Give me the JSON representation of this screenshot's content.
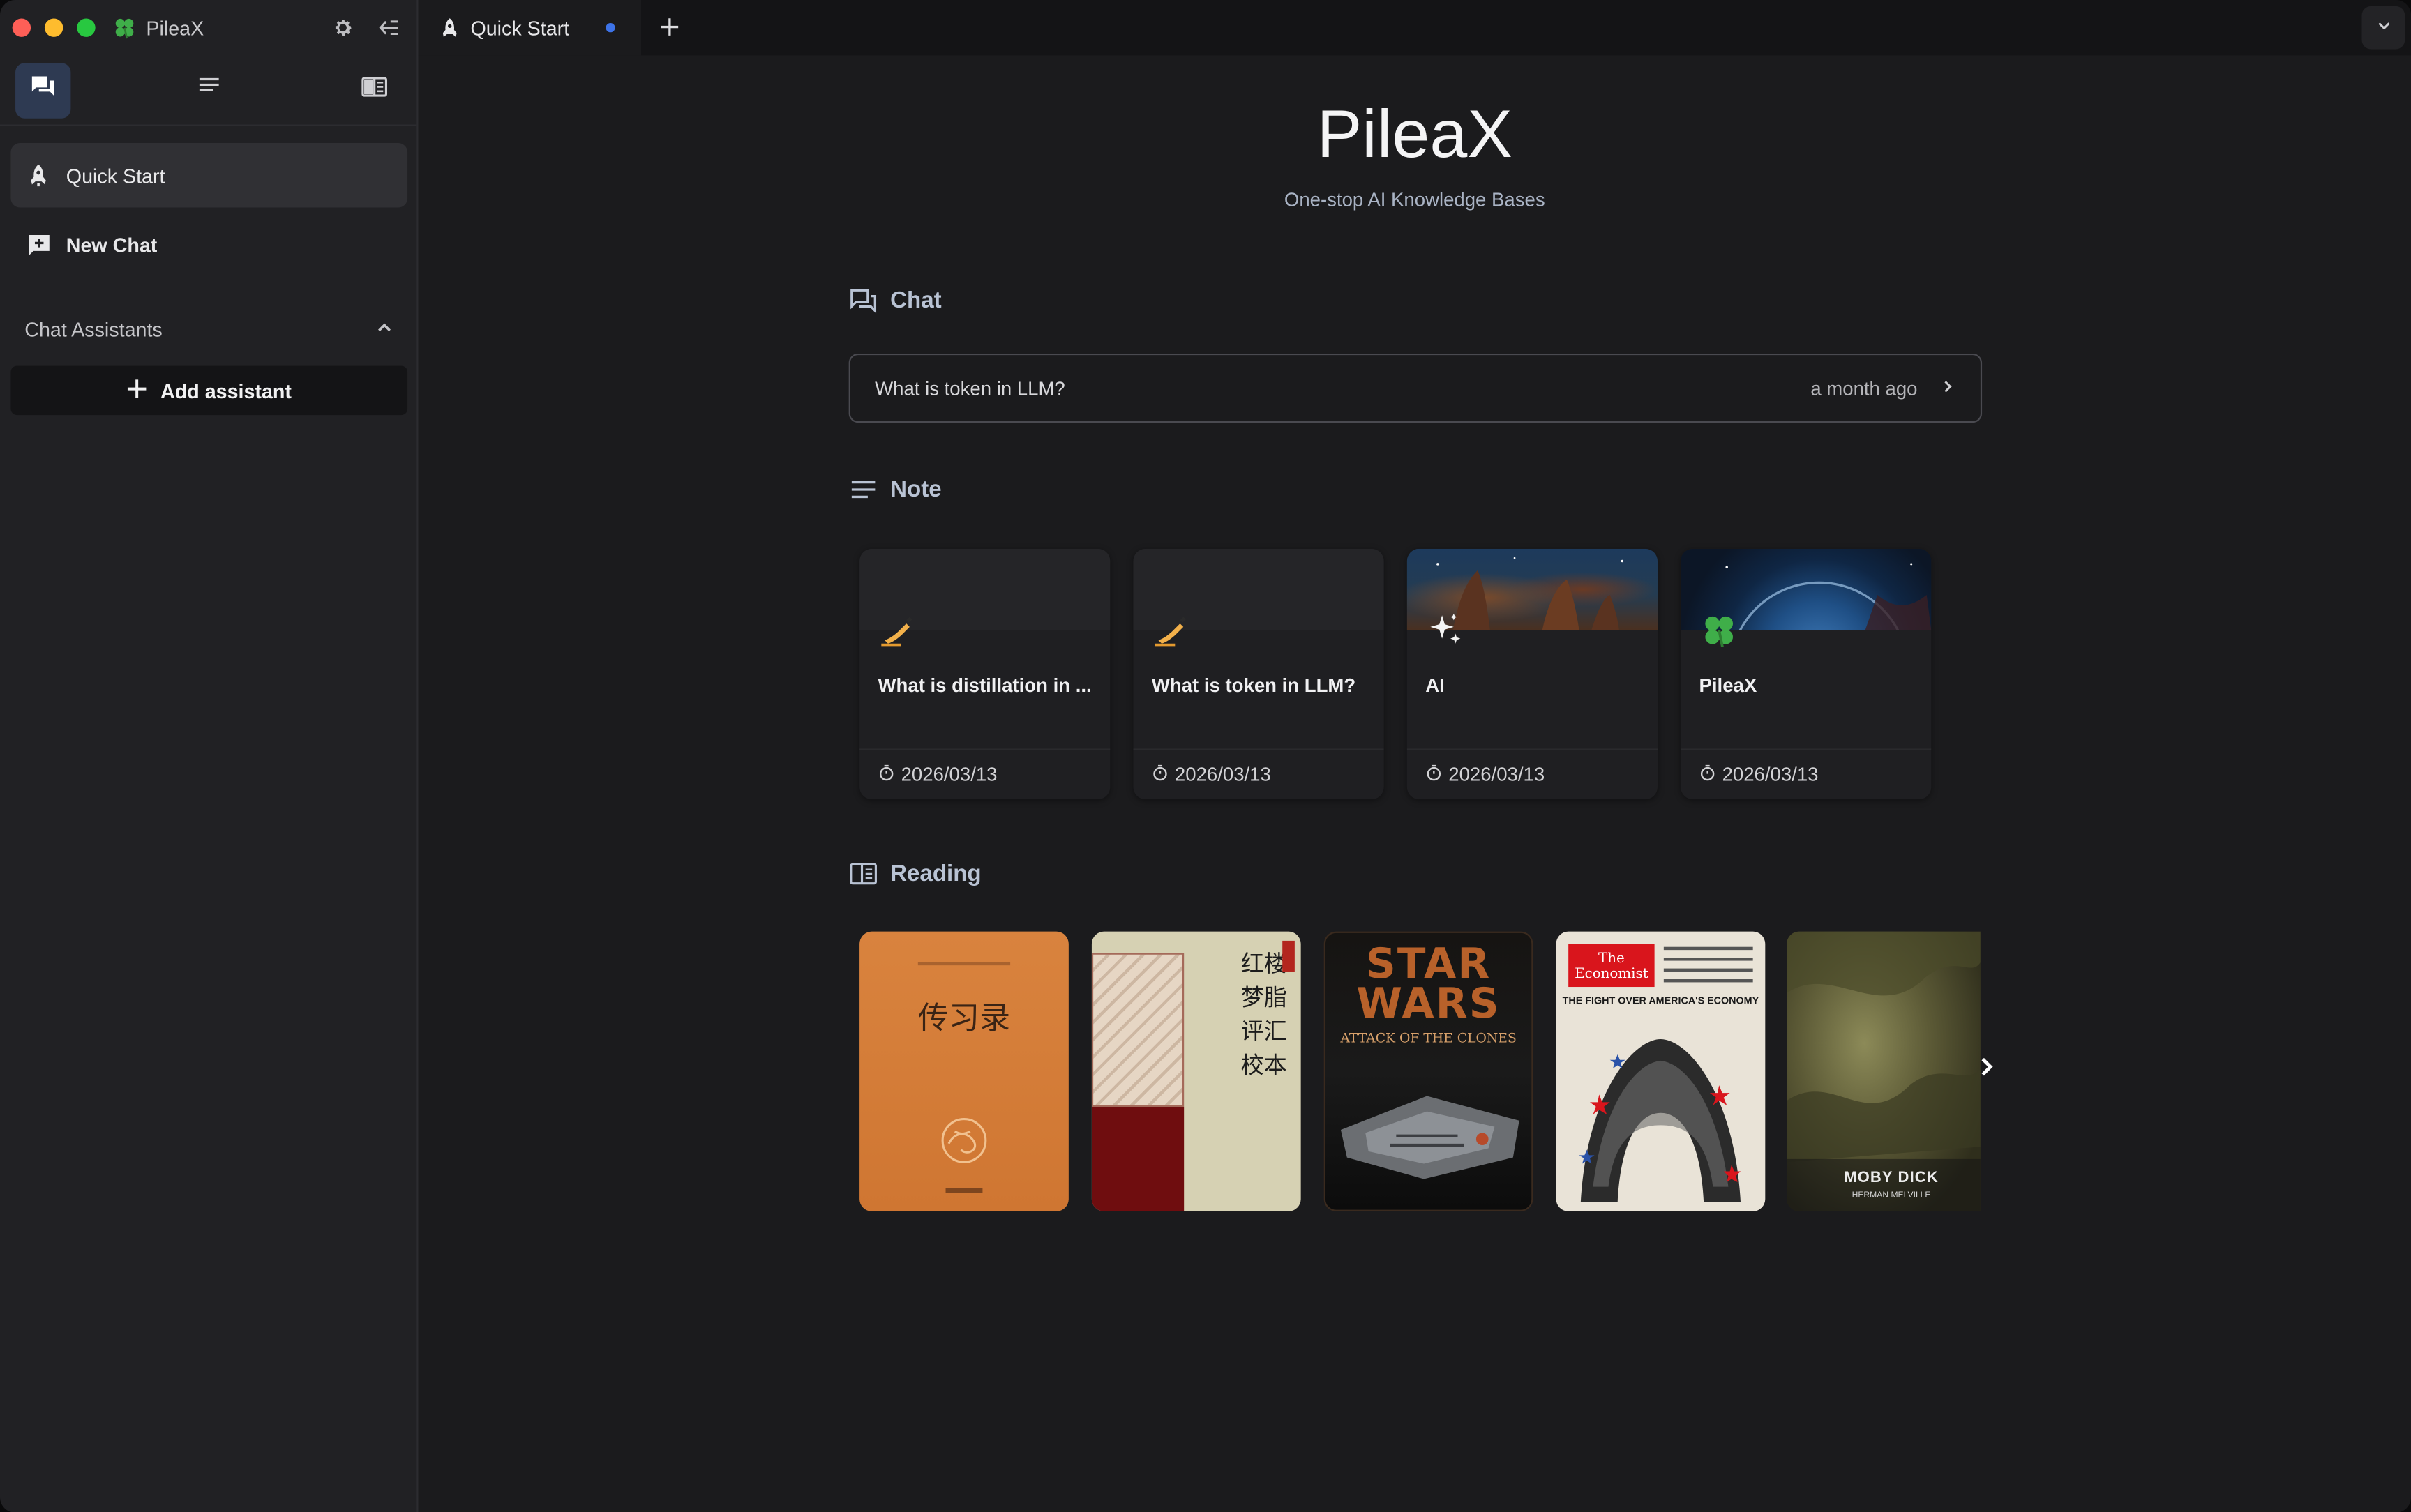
{
  "app": {
    "name": "PileaX"
  },
  "sidebar": {
    "nav": [
      {
        "label": "Quick Start",
        "icon": "rocket-icon",
        "active": true
      },
      {
        "label": "New Chat",
        "icon": "new-chat-icon",
        "active": false
      }
    ],
    "section_label": "Chat Assistants",
    "add_assistant_label": "Add assistant"
  },
  "tabs": [
    {
      "label": "Quick Start",
      "icon": "rocket-icon",
      "unsaved": true
    }
  ],
  "hero": {
    "title": "PileaX",
    "subtitle": "One-stop AI Knowledge Bases"
  },
  "chat_section": {
    "heading": "Chat",
    "items": [
      {
        "title": "What is token in LLM?",
        "time": "a month ago"
      }
    ]
  },
  "note_section": {
    "heading": "Note",
    "items": [
      {
        "title": "What is distillation in ...",
        "emoji": "✍️",
        "date": "2026/03/13",
        "cover": "none"
      },
      {
        "title": "What is token in LLM?",
        "emoji": "✍️",
        "date": "2026/03/13",
        "cover": "none"
      },
      {
        "title": "AI",
        "emoji": "✨",
        "date": "2026/03/13",
        "cover": "nebula"
      },
      {
        "title": "PileaX",
        "emoji": "🍀",
        "date": "2026/03/13",
        "cover": "planet"
      }
    ]
  },
  "reading_section": {
    "heading": "Reading",
    "books": [
      {
        "cover_text": "传习录",
        "kind": "chuanxilu"
      },
      {
        "cover_text": "红楼梦脂评汇校本",
        "kind": "hongloumeng"
      },
      {
        "cover_text": "STAR WARS",
        "cover_sub": "ATTACK OF THE CLONES",
        "kind": "starwars"
      },
      {
        "cover_text": "The Economist",
        "cover_sub": "THE FIGHT OVER AMERICA'S ECONOMY",
        "kind": "economist"
      },
      {
        "cover_text": "MOBY DICK",
        "cover_sub": "HERMAN MELVILLE",
        "kind": "mobydick"
      }
    ]
  },
  "colors": {
    "accent_dot": "#3d73e8",
    "active_mode_bg": "#2e3a52",
    "section_heading": "#b9c3d4"
  }
}
